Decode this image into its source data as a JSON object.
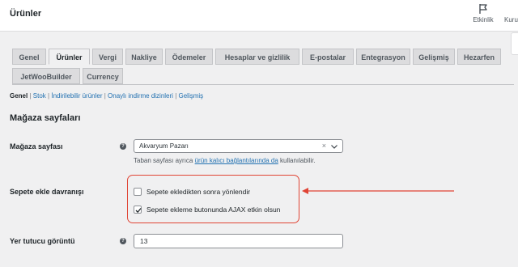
{
  "header": {
    "title": "Ürünler",
    "activity_label": "Etkinlik",
    "cut_label": "Kuru"
  },
  "tabs": [
    {
      "label": "Genel",
      "active": false
    },
    {
      "label": "Ürünler",
      "active": true
    },
    {
      "label": "Vergi",
      "active": false
    },
    {
      "label": "Nakliye",
      "active": false
    },
    {
      "label": "Ödemeler",
      "active": false
    },
    {
      "label": "Hesaplar ve gizlilik",
      "active": false
    },
    {
      "label": "E-postalar",
      "active": false
    },
    {
      "label": "Entegrasyon",
      "active": false
    },
    {
      "label": "Gelişmiş",
      "active": false
    },
    {
      "label": "Hezarfen",
      "active": false
    },
    {
      "label": "JetWooBuilder",
      "active": false
    },
    {
      "label": "Currency",
      "active": false
    }
  ],
  "subnav": {
    "current": "Genel",
    "sep": "|",
    "items": [
      "Stok",
      "İndirilebilir ürünler",
      "Onaylı indirme dizinleri",
      "Gelişmiş"
    ]
  },
  "section_title": "Mağaza sayfaları",
  "shop_page": {
    "label": "Mağaza sayfası",
    "value": "Akvaryum Pazarı",
    "clear": "×",
    "desc_before": "Taban sayfası ayrıca",
    "desc_link": "ürün kalıcı bağlantılarında da",
    "desc_after": "kullanılabilir."
  },
  "cart_behavior": {
    "label": "Sepete ekle davranışı",
    "options": [
      {
        "label": "Sepete ekledikten sonra yönlendir",
        "checked": false
      },
      {
        "label": "Sepete ekleme butonunda AJAX etkin olsun",
        "checked": true
      }
    ]
  },
  "placeholder_image": {
    "label": "Yer tutucu görüntü",
    "value": "13"
  },
  "help_glyph": "?",
  "colors": {
    "annotation": "#e04435",
    "link": "#2271b1"
  },
  "icons": {
    "flag": "flag-icon",
    "help": "help-icon",
    "chevron": "chevron-down-icon",
    "check": "check-icon",
    "arrow": "arrow-left-icon"
  }
}
